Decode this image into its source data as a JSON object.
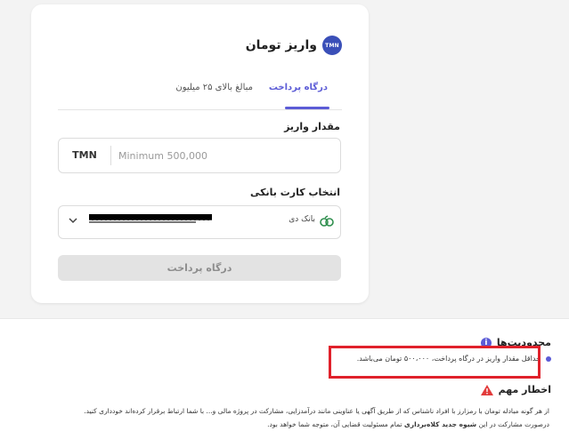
{
  "card": {
    "title": "واریز تومان",
    "logo_text": "TMN",
    "tabs": [
      {
        "label": "درگاه پرداخت",
        "active": true
      },
      {
        "label": "مبالغ بالای ۲۵ میلیون",
        "active": false
      }
    ],
    "amount_label": "مقدار واریز",
    "amount_currency": "TMN",
    "amount_placeholder": "Minimum 500,000",
    "card_label": "انتخاب کارت بانکی",
    "bank_name": "بانک دی",
    "submit_label": "درگاه پرداخت"
  },
  "limits": {
    "heading": "محدودیت‌ها",
    "min_deposit_text": "حداقل مقدار واریز در درگاه پرداخت، ۵۰۰،۰۰۰ تومان می‌باشد."
  },
  "warning": {
    "heading": "اخطار مهم",
    "line1": "از هر گونه مبادله تومان با رمزارز با افراد ناشناس که از طریق آگهی یا عناوینی مانند درآمدزایی، مشارکت در پروژه مالی و... با شما ارتباط برقرار کرده‌اند خودداری کنید.",
    "line2_pre": "درصورت مشارکت در این",
    "line2_bold": "شیوه جدید کلاه‌برداری",
    "line2_post": "تمام مسئولیت قضایی آن، متوجه شما خواهد بود."
  },
  "colors": {
    "accent": "#5b5bd6",
    "highlight_box": "#e0212b",
    "warning": "#e23b3b"
  }
}
